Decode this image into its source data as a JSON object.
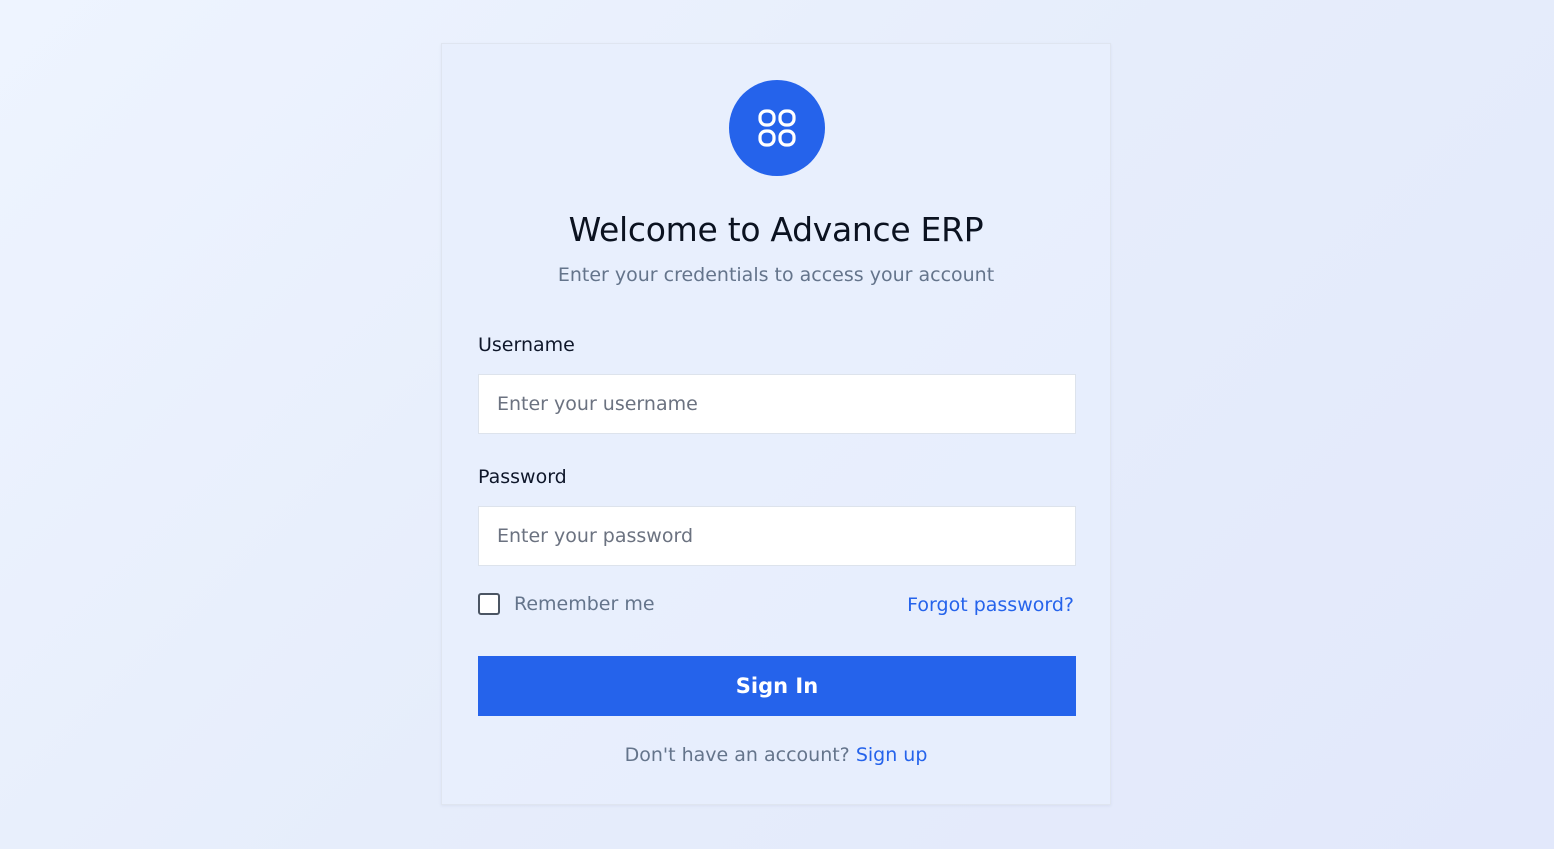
{
  "brand": {
    "logo_icon": "apps-grid-icon",
    "accent_color": "#2563eb"
  },
  "header": {
    "title": "Welcome to Advance ERP",
    "subtitle": "Enter your credentials to access your account"
  },
  "form": {
    "username": {
      "label": "Username",
      "placeholder": "Enter your username",
      "value": ""
    },
    "password": {
      "label": "Password",
      "placeholder": "Enter your password",
      "value": ""
    },
    "remember_me": {
      "label": "Remember me",
      "checked": false
    },
    "forgot_password_label": "Forgot password?",
    "submit_label": "Sign In"
  },
  "footer": {
    "prompt": "Don't have an account?",
    "signup_label": "Sign up"
  }
}
